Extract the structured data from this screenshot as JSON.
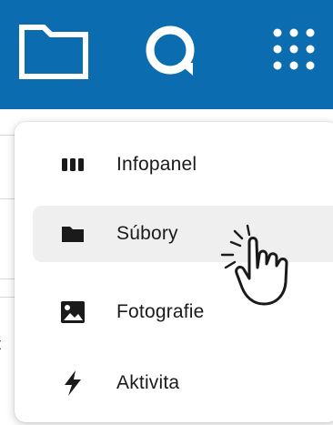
{
  "topbar": {
    "background": "#0b6cb0",
    "icons": [
      "folder-icon",
      "search-icon",
      "apps-grid-icon"
    ]
  },
  "background_fragment": "t",
  "menu": {
    "items": [
      {
        "label": "Infopanel",
        "icon": "dashboard-icon",
        "active": false
      },
      {
        "label": "Súbory",
        "icon": "folder-icon",
        "active": true
      },
      {
        "label": "Fotografie",
        "icon": "image-icon",
        "active": false
      },
      {
        "label": "Aktivita",
        "icon": "lightning-icon",
        "active": false
      }
    ]
  },
  "cursor": "hand-pointer-icon"
}
